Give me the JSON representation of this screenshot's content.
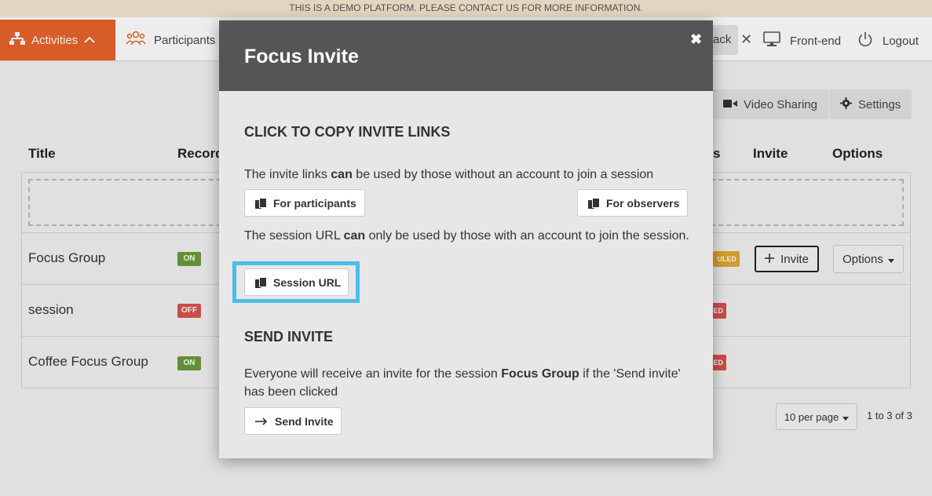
{
  "banner": {
    "text": "THIS IS A DEMO PLATFORM. PLEASE CONTACT US FOR MORE INFORMATION."
  },
  "nav": {
    "activities": "Activities",
    "participants": "Participants",
    "back": "ack",
    "frontend": "Front-end",
    "logout": "Logout",
    "accent_color": "#e8632b"
  },
  "toolbar": {
    "video_sharing": "Video Sharing",
    "settings": "Settings"
  },
  "table": {
    "headers": {
      "title": "Title",
      "record": "Record",
      "status": "s",
      "invite": "Invite",
      "options": "Options"
    },
    "rows": [
      {
        "title": "Focus Group",
        "record": "ON",
        "status": "ULED"
      },
      {
        "title": "session",
        "record": "OFF",
        "status": "ED"
      },
      {
        "title": "Coffee Focus Group",
        "record": "ON",
        "status": "ED"
      }
    ],
    "invite_button": "Invite",
    "options_button": "Options"
  },
  "pagination": {
    "per_page": "10 per page",
    "count": "1 to 3 of 3"
  },
  "modal": {
    "title": "Focus Invite",
    "copy_section": "CLICK TO COPY INVITE LINKS",
    "invite_links_pre": "The invite links ",
    "invite_links_bold": "can",
    "invite_links_post": " be used by those without an account to join a session",
    "for_participants": "For participants",
    "for_observers": "For observers",
    "session_url_pre": "The session URL ",
    "session_url_bold": "can",
    "session_url_post": " only be used by those with an account to join the session.",
    "session_url_button": "Session URL",
    "send_section": "SEND INVITE",
    "send_pre": "Everyone will receive an invite for the session ",
    "send_bold": "Focus Group",
    "send_post": " if the 'Send invite' has been clicked",
    "send_button": "Send Invite",
    "highlight_color": "#4bbde8"
  }
}
